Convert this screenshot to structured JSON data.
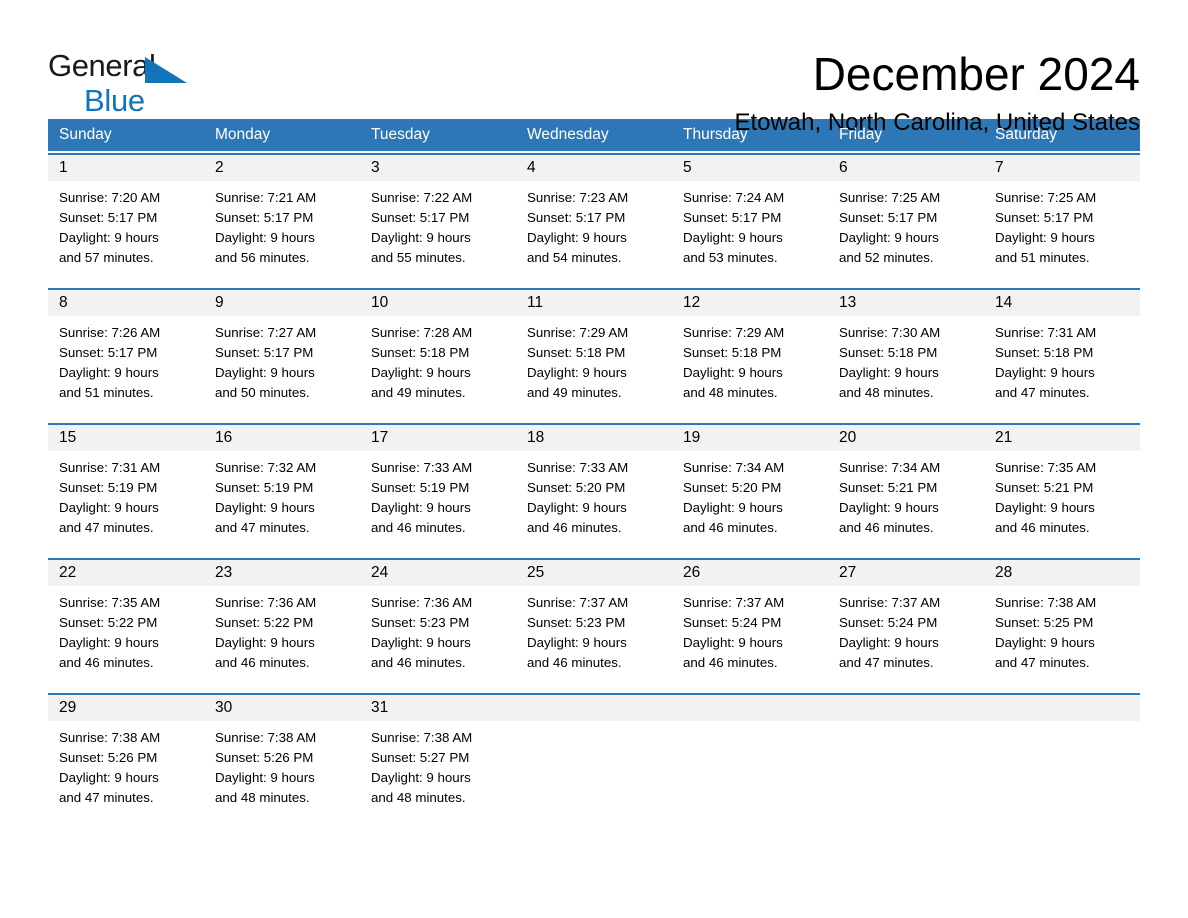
{
  "brand": {
    "name_part1": "General",
    "name_part2": "Blue",
    "accent_color": "#1275bb"
  },
  "header": {
    "month_title": "December 2024",
    "location": "Etowah, North Carolina, United States"
  },
  "calendar": {
    "header_color": "#2e77b6",
    "day_band_color": "#f2f2f2",
    "weekdays": [
      "Sunday",
      "Monday",
      "Tuesday",
      "Wednesday",
      "Thursday",
      "Friday",
      "Saturday"
    ],
    "weeks": [
      [
        {
          "day": "1",
          "sunrise": "Sunrise: 7:20 AM",
          "sunset": "Sunset: 5:17 PM",
          "daylight_line1": "Daylight: 9 hours",
          "daylight_line2": "and 57 minutes."
        },
        {
          "day": "2",
          "sunrise": "Sunrise: 7:21 AM",
          "sunset": "Sunset: 5:17 PM",
          "daylight_line1": "Daylight: 9 hours",
          "daylight_line2": "and 56 minutes."
        },
        {
          "day": "3",
          "sunrise": "Sunrise: 7:22 AM",
          "sunset": "Sunset: 5:17 PM",
          "daylight_line1": "Daylight: 9 hours",
          "daylight_line2": "and 55 minutes."
        },
        {
          "day": "4",
          "sunrise": "Sunrise: 7:23 AM",
          "sunset": "Sunset: 5:17 PM",
          "daylight_line1": "Daylight: 9 hours",
          "daylight_line2": "and 54 minutes."
        },
        {
          "day": "5",
          "sunrise": "Sunrise: 7:24 AM",
          "sunset": "Sunset: 5:17 PM",
          "daylight_line1": "Daylight: 9 hours",
          "daylight_line2": "and 53 minutes."
        },
        {
          "day": "6",
          "sunrise": "Sunrise: 7:25 AM",
          "sunset": "Sunset: 5:17 PM",
          "daylight_line1": "Daylight: 9 hours",
          "daylight_line2": "and 52 minutes."
        },
        {
          "day": "7",
          "sunrise": "Sunrise: 7:25 AM",
          "sunset": "Sunset: 5:17 PM",
          "daylight_line1": "Daylight: 9 hours",
          "daylight_line2": "and 51 minutes."
        }
      ],
      [
        {
          "day": "8",
          "sunrise": "Sunrise: 7:26 AM",
          "sunset": "Sunset: 5:17 PM",
          "daylight_line1": "Daylight: 9 hours",
          "daylight_line2": "and 51 minutes."
        },
        {
          "day": "9",
          "sunrise": "Sunrise: 7:27 AM",
          "sunset": "Sunset: 5:17 PM",
          "daylight_line1": "Daylight: 9 hours",
          "daylight_line2": "and 50 minutes."
        },
        {
          "day": "10",
          "sunrise": "Sunrise: 7:28 AM",
          "sunset": "Sunset: 5:18 PM",
          "daylight_line1": "Daylight: 9 hours",
          "daylight_line2": "and 49 minutes."
        },
        {
          "day": "11",
          "sunrise": "Sunrise: 7:29 AM",
          "sunset": "Sunset: 5:18 PM",
          "daylight_line1": "Daylight: 9 hours",
          "daylight_line2": "and 49 minutes."
        },
        {
          "day": "12",
          "sunrise": "Sunrise: 7:29 AM",
          "sunset": "Sunset: 5:18 PM",
          "daylight_line1": "Daylight: 9 hours",
          "daylight_line2": "and 48 minutes."
        },
        {
          "day": "13",
          "sunrise": "Sunrise: 7:30 AM",
          "sunset": "Sunset: 5:18 PM",
          "daylight_line1": "Daylight: 9 hours",
          "daylight_line2": "and 48 minutes."
        },
        {
          "day": "14",
          "sunrise": "Sunrise: 7:31 AM",
          "sunset": "Sunset: 5:18 PM",
          "daylight_line1": "Daylight: 9 hours",
          "daylight_line2": "and 47 minutes."
        }
      ],
      [
        {
          "day": "15",
          "sunrise": "Sunrise: 7:31 AM",
          "sunset": "Sunset: 5:19 PM",
          "daylight_line1": "Daylight: 9 hours",
          "daylight_line2": "and 47 minutes."
        },
        {
          "day": "16",
          "sunrise": "Sunrise: 7:32 AM",
          "sunset": "Sunset: 5:19 PM",
          "daylight_line1": "Daylight: 9 hours",
          "daylight_line2": "and 47 minutes."
        },
        {
          "day": "17",
          "sunrise": "Sunrise: 7:33 AM",
          "sunset": "Sunset: 5:19 PM",
          "daylight_line1": "Daylight: 9 hours",
          "daylight_line2": "and 46 minutes."
        },
        {
          "day": "18",
          "sunrise": "Sunrise: 7:33 AM",
          "sunset": "Sunset: 5:20 PM",
          "daylight_line1": "Daylight: 9 hours",
          "daylight_line2": "and 46 minutes."
        },
        {
          "day": "19",
          "sunrise": "Sunrise: 7:34 AM",
          "sunset": "Sunset: 5:20 PM",
          "daylight_line1": "Daylight: 9 hours",
          "daylight_line2": "and 46 minutes."
        },
        {
          "day": "20",
          "sunrise": "Sunrise: 7:34 AM",
          "sunset": "Sunset: 5:21 PM",
          "daylight_line1": "Daylight: 9 hours",
          "daylight_line2": "and 46 minutes."
        },
        {
          "day": "21",
          "sunrise": "Sunrise: 7:35 AM",
          "sunset": "Sunset: 5:21 PM",
          "daylight_line1": "Daylight: 9 hours",
          "daylight_line2": "and 46 minutes."
        }
      ],
      [
        {
          "day": "22",
          "sunrise": "Sunrise: 7:35 AM",
          "sunset": "Sunset: 5:22 PM",
          "daylight_line1": "Daylight: 9 hours",
          "daylight_line2": "and 46 minutes."
        },
        {
          "day": "23",
          "sunrise": "Sunrise: 7:36 AM",
          "sunset": "Sunset: 5:22 PM",
          "daylight_line1": "Daylight: 9 hours",
          "daylight_line2": "and 46 minutes."
        },
        {
          "day": "24",
          "sunrise": "Sunrise: 7:36 AM",
          "sunset": "Sunset: 5:23 PM",
          "daylight_line1": "Daylight: 9 hours",
          "daylight_line2": "and 46 minutes."
        },
        {
          "day": "25",
          "sunrise": "Sunrise: 7:37 AM",
          "sunset": "Sunset: 5:23 PM",
          "daylight_line1": "Daylight: 9 hours",
          "daylight_line2": "and 46 minutes."
        },
        {
          "day": "26",
          "sunrise": "Sunrise: 7:37 AM",
          "sunset": "Sunset: 5:24 PM",
          "daylight_line1": "Daylight: 9 hours",
          "daylight_line2": "and 46 minutes."
        },
        {
          "day": "27",
          "sunrise": "Sunrise: 7:37 AM",
          "sunset": "Sunset: 5:24 PM",
          "daylight_line1": "Daylight: 9 hours",
          "daylight_line2": "and 47 minutes."
        },
        {
          "day": "28",
          "sunrise": "Sunrise: 7:38 AM",
          "sunset": "Sunset: 5:25 PM",
          "daylight_line1": "Daylight: 9 hours",
          "daylight_line2": "and 47 minutes."
        }
      ],
      [
        {
          "day": "29",
          "sunrise": "Sunrise: 7:38 AM",
          "sunset": "Sunset: 5:26 PM",
          "daylight_line1": "Daylight: 9 hours",
          "daylight_line2": "and 47 minutes."
        },
        {
          "day": "30",
          "sunrise": "Sunrise: 7:38 AM",
          "sunset": "Sunset: 5:26 PM",
          "daylight_line1": "Daylight: 9 hours",
          "daylight_line2": "and 48 minutes."
        },
        {
          "day": "31",
          "sunrise": "Sunrise: 7:38 AM",
          "sunset": "Sunset: 5:27 PM",
          "daylight_line1": "Daylight: 9 hours",
          "daylight_line2": "and 48 minutes."
        },
        {
          "day": "",
          "sunrise": "",
          "sunset": "",
          "daylight_line1": "",
          "daylight_line2": ""
        },
        {
          "day": "",
          "sunrise": "",
          "sunset": "",
          "daylight_line1": "",
          "daylight_line2": ""
        },
        {
          "day": "",
          "sunrise": "",
          "sunset": "",
          "daylight_line1": "",
          "daylight_line2": ""
        },
        {
          "day": "",
          "sunrise": "",
          "sunset": "",
          "daylight_line1": "",
          "daylight_line2": ""
        }
      ]
    ]
  }
}
